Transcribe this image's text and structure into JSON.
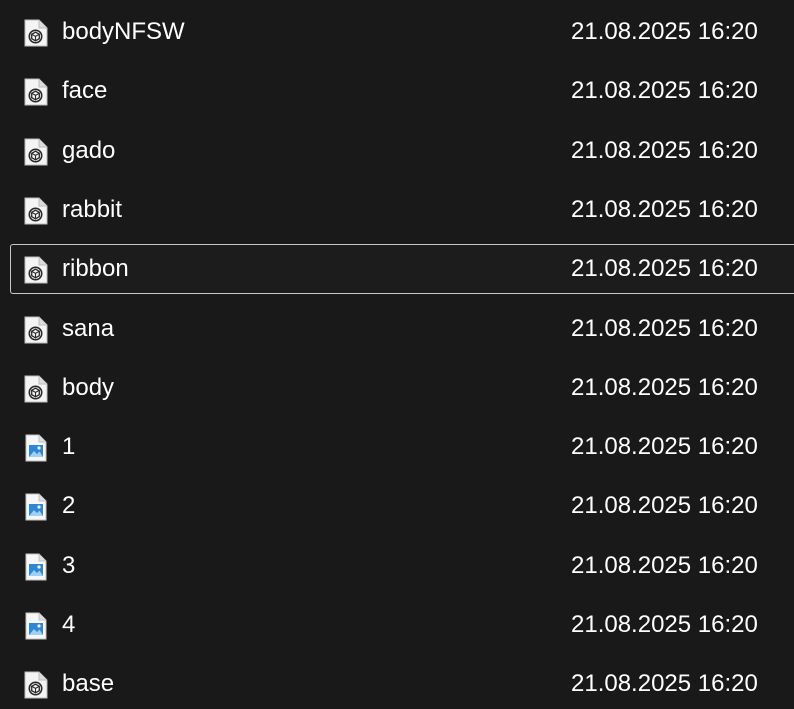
{
  "files": [
    {
      "name": "bodyNFSW",
      "date": "21.08.2025 16:20",
      "icon": "3d-object-file-icon",
      "selected": false
    },
    {
      "name": "face",
      "date": "21.08.2025 16:20",
      "icon": "3d-object-file-icon",
      "selected": false
    },
    {
      "name": "gado",
      "date": "21.08.2025 16:20",
      "icon": "3d-object-file-icon",
      "selected": false
    },
    {
      "name": "rabbit",
      "date": "21.08.2025 16:20",
      "icon": "3d-object-file-icon",
      "selected": false
    },
    {
      "name": "ribbon",
      "date": "21.08.2025 16:20",
      "icon": "3d-object-file-icon",
      "selected": true
    },
    {
      "name": "sana",
      "date": "21.08.2025 16:20",
      "icon": "3d-object-file-icon",
      "selected": false
    },
    {
      "name": "body",
      "date": "21.08.2025 16:20",
      "icon": "3d-object-file-icon",
      "selected": false
    },
    {
      "name": "1",
      "date": "21.08.2025 16:20",
      "icon": "image-file-icon",
      "selected": false
    },
    {
      "name": "2",
      "date": "21.08.2025 16:20",
      "icon": "image-file-icon",
      "selected": false
    },
    {
      "name": "3",
      "date": "21.08.2025 16:20",
      "icon": "image-file-icon",
      "selected": false
    },
    {
      "name": "4",
      "date": "21.08.2025 16:20",
      "icon": "image-file-icon",
      "selected": false
    },
    {
      "name": "base",
      "date": "21.08.2025 16:20",
      "icon": "3d-object-file-icon",
      "selected": false
    }
  ]
}
